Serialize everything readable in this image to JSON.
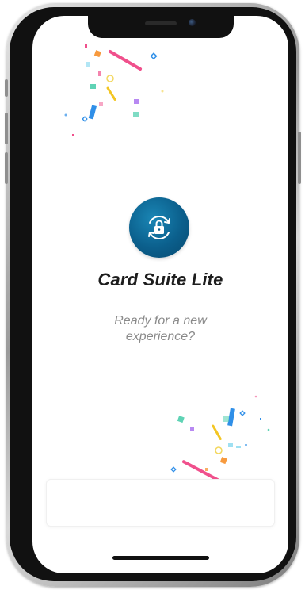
{
  "app": {
    "title": "Card Suite Lite",
    "subtitle": "Ready for a new experience?",
    "logo_icon": "lock-refresh-icon"
  },
  "colors": {
    "logo_bg": "#0b5f8c",
    "title_text": "#1d1d1d",
    "subtitle_text": "#8a8a8a",
    "confetti_pink": "#f0508c",
    "confetti_blue": "#2f8fe8",
    "confetti_yellow": "#f3c623",
    "confetti_orange": "#f79a3e",
    "confetti_purple": "#b889f2",
    "confetti_teal": "#5fd3b5"
  }
}
